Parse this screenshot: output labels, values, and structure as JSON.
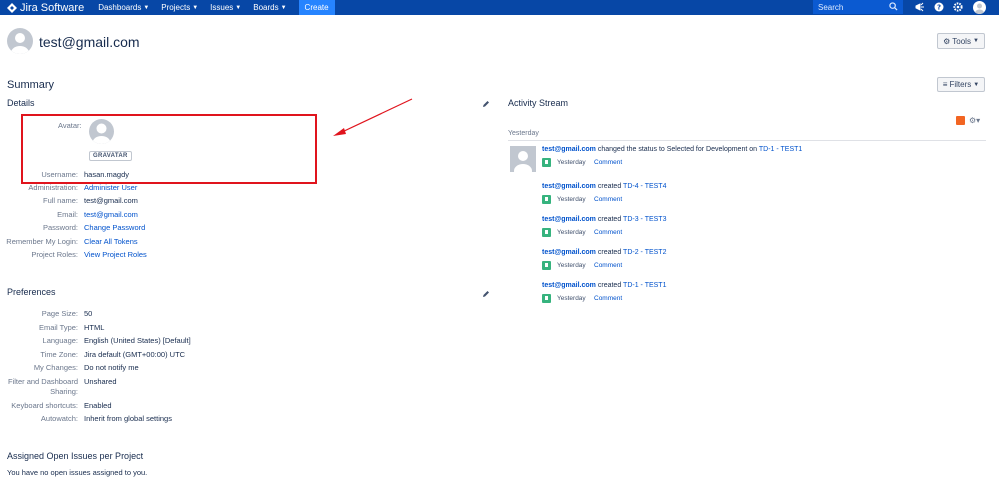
{
  "nav": {
    "brand": "Jira Software",
    "menus": [
      "Dashboards",
      "Projects",
      "Issues",
      "Boards"
    ],
    "create_label": "Create",
    "search_placeholder": "Search"
  },
  "header": {
    "title": "test@gmail.com",
    "tools_label": "Tools"
  },
  "summary": {
    "heading": "Summary",
    "filters_label": "Filters"
  },
  "details": {
    "heading": "Details",
    "avatar_label": "Avatar:",
    "gravatar_label": "GRAVATAR",
    "rows": [
      {
        "label": "Username:",
        "value": "hasan.magdy",
        "link": false
      },
      {
        "label": "Administration:",
        "value": "Administer User",
        "link": true
      },
      {
        "label": "Full name:",
        "value": "test@gmail.com",
        "link": false
      },
      {
        "label": "Email:",
        "value": "test@gmail.com",
        "link": true
      },
      {
        "label": "Password:",
        "value": "Change Password",
        "link": true
      },
      {
        "label": "Remember My Login:",
        "value": "Clear All Tokens",
        "link": true
      },
      {
        "label": "Project Roles:",
        "value": "View Project Roles",
        "link": true
      }
    ]
  },
  "preferences": {
    "heading": "Preferences",
    "rows": [
      {
        "label": "Page Size:",
        "value": "50"
      },
      {
        "label": "Email Type:",
        "value": "HTML"
      },
      {
        "label": "Language:",
        "value": "English (United States) [Default]"
      },
      {
        "label": "Time Zone:",
        "value": "Jira default (GMT+00:00) UTC"
      },
      {
        "label": "My Changes:",
        "value": "Do not notify me"
      },
      {
        "label": "Filter and Dashboard Sharing:",
        "label_line1": "Filter and Dashboard",
        "label_line2": "Sharing:",
        "value": "Unshared"
      },
      {
        "label": "Keyboard shortcuts:",
        "value": "Enabled"
      },
      {
        "label": "Autowatch:",
        "value": "Inherit from global settings"
      }
    ]
  },
  "assigned": {
    "heading": "Assigned Open Issues per Project",
    "message": "You have no open issues assigned to you."
  },
  "activity": {
    "heading": "Activity Stream",
    "group_label": "Yesterday",
    "items": [
      {
        "user": "test@gmail.com",
        "action": "changed the status to Selected for Development on",
        "issue": "TD-1 - TEST1",
        "when": "Yesterday",
        "comment": "Comment"
      },
      {
        "user": "test@gmail.com",
        "action": "created",
        "issue": "TD-4 - TEST4",
        "when": "Yesterday",
        "comment": "Comment"
      },
      {
        "user": "test@gmail.com",
        "action": "created",
        "issue": "TD-3 - TEST3",
        "when": "Yesterday",
        "comment": "Comment"
      },
      {
        "user": "test@gmail.com",
        "action": "created",
        "issue": "TD-2 - TEST2",
        "when": "Yesterday",
        "comment": "Comment"
      },
      {
        "user": "test@gmail.com",
        "action": "created",
        "issue": "TD-1 - TEST1",
        "when": "Yesterday",
        "comment": "Comment"
      }
    ]
  },
  "colors": {
    "nav_bg": "#0747a6",
    "create_bg": "#2684ff",
    "link": "#0052cc",
    "highlight_box": "#e0141d"
  }
}
